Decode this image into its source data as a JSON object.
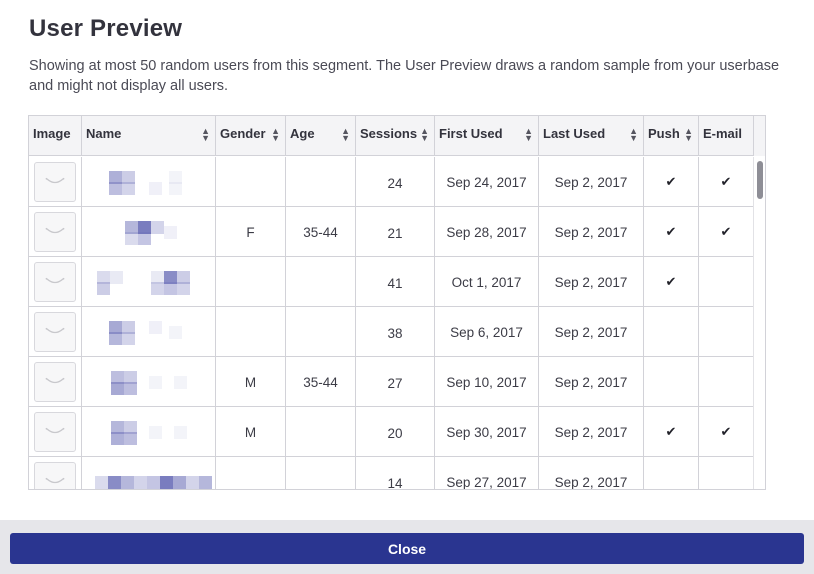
{
  "modal": {
    "title": "User Preview",
    "description": "Showing at most 50 random users from this segment. The User Preview draws a random sample from your userbase and might not display all users.",
    "close_label": "Close"
  },
  "table": {
    "columns": [
      {
        "label": "Image",
        "sortable": false
      },
      {
        "label": "Name",
        "sortable": true
      },
      {
        "label": "Gender",
        "sortable": true
      },
      {
        "label": "Age",
        "sortable": true
      },
      {
        "label": "Sessions",
        "sortable": true
      },
      {
        "label": "First Used",
        "sortable": true
      },
      {
        "label": "Last Used",
        "sortable": true
      },
      {
        "label": "Push",
        "sortable": true
      },
      {
        "label": "E-mail",
        "sortable": false
      }
    ],
    "check_glyph": "✔",
    "rows": [
      {
        "gender": "",
        "age": "",
        "sessions": "24",
        "first_used": "Sep 24, 2017",
        "last_used": "Sep 2, 2017",
        "push": true,
        "email": true
      },
      {
        "gender": "F",
        "age": "35-44",
        "sessions": "21",
        "first_used": "Sep 28, 2017",
        "last_used": "Sep 2, 2017",
        "push": true,
        "email": true
      },
      {
        "gender": "",
        "age": "",
        "sessions": "41",
        "first_used": "Oct 1, 2017",
        "last_used": "Sep 2, 2017",
        "push": true,
        "email": false
      },
      {
        "gender": "",
        "age": "",
        "sessions": "38",
        "first_used": "Sep 6, 2017",
        "last_used": "Sep 2, 2017",
        "push": false,
        "email": false
      },
      {
        "gender": "M",
        "age": "35-44",
        "sessions": "27",
        "first_used": "Sep 10, 2017",
        "last_used": "Sep 2, 2017",
        "push": false,
        "email": false
      },
      {
        "gender": "M",
        "age": "",
        "sessions": "20",
        "first_used": "Sep 30, 2017",
        "last_used": "Sep 2, 2017",
        "push": true,
        "email": true
      },
      {
        "gender": "",
        "age": "",
        "sessions": "14",
        "first_used": "Sep 27, 2017",
        "last_used": "Sep 2, 2017",
        "push": false,
        "email": false
      }
    ]
  },
  "colors": {
    "primary_button": "#2a3590",
    "pixelated_name": "#6c6fb8"
  },
  "icons": {
    "avatar": "default-avatar-icon",
    "sort": "sort-arrows-icon",
    "check": "checkmark-icon"
  }
}
